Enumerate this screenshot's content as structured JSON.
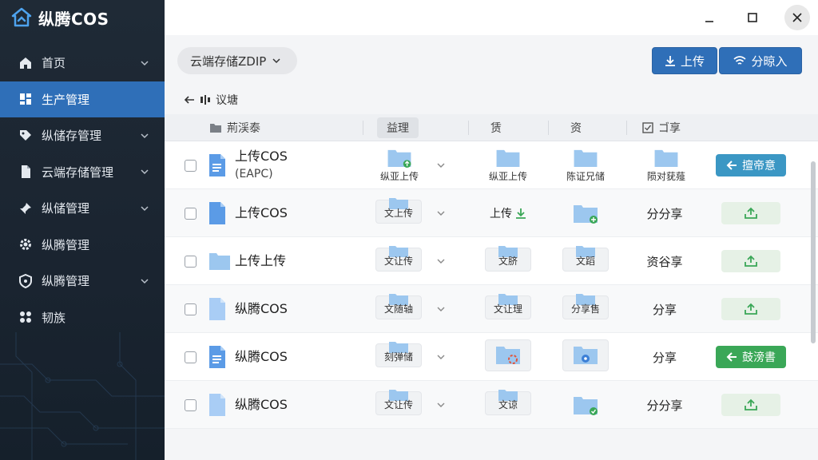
{
  "app": {
    "title": "纵腾COS"
  },
  "sidebar": {
    "items": [
      {
        "label": "首页",
        "icon": "home-icon",
        "chevron": true,
        "active": false
      },
      {
        "label": "生产管理",
        "icon": "grid-icon",
        "chevron": false,
        "active": true
      },
      {
        "label": "纵储存管理",
        "icon": "tag-icon",
        "chevron": true,
        "active": false
      },
      {
        "label": "云端存储管理",
        "icon": "document-icon",
        "chevron": true,
        "active": false
      },
      {
        "label": "纵储管理",
        "icon": "pin-icon",
        "chevron": true,
        "active": false
      },
      {
        "label": "纵腾管理",
        "icon": "gear-icon",
        "chevron": false,
        "active": false
      },
      {
        "label": "纵腾管理",
        "icon": "shield-icon",
        "chevron": true,
        "active": false
      },
      {
        "label": "韧族",
        "icon": "apps-icon",
        "chevron": false,
        "active": false
      }
    ]
  },
  "toolbar": {
    "location": "云端存储ZDIP",
    "upload_label": "上传",
    "share_label": "分晾入"
  },
  "breadcrumb": {
    "text": "议塘"
  },
  "table": {
    "headers": {
      "name": "荊渓泰",
      "manage": "益理",
      "c3": "赁",
      "c4": "资",
      "c5": "ゴ享"
    },
    "rows": [
      {
        "name": "上传COS",
        "sub": "(EAPC)",
        "file_icon": "doc-icon",
        "c2_caption": "纵亚上传",
        "c3_caption": "纵亚上传",
        "c4_caption": "陈证兄储",
        "c5_caption": "陨对莸薤",
        "action": {
          "style": "teal",
          "label": "擅帝意",
          "icon": "arrow-left-icon"
        }
      },
      {
        "name": "上传COS",
        "file_icon": "file-icon",
        "c2_tile": "文上传",
        "c3_text": "上传",
        "share": "分分享",
        "action": {
          "style": "light",
          "label": "",
          "icon": "share-up-icon"
        }
      },
      {
        "name": "上传上传",
        "file_icon": "folder-icon",
        "c2_tile": "文让传",
        "c3_tile": "文脐",
        "c4_tile": "文蹈",
        "share": "资谷享",
        "action": {
          "style": "light",
          "label": "",
          "icon": "share-up-icon"
        }
      },
      {
        "name": "纵腾COS",
        "file_icon": "file-icon",
        "c2_tile": "文随轴",
        "c3_tile": "文让理",
        "c4_tile": "分享售",
        "share": "分享",
        "action": {
          "style": "light",
          "label": "",
          "icon": "share-up-icon"
        }
      },
      {
        "name": "纵腾COS",
        "file_icon": "doc-icon",
        "c2_tile": "刻弹储",
        "share": "分享",
        "action": {
          "style": "green",
          "label": "鼓滂書",
          "icon": "arrow-left-icon"
        }
      },
      {
        "name": "纵腾COS",
        "file_icon": "file-icon",
        "c2_tile": "文让传",
        "c3_tile": "文谅",
        "share": "分分享",
        "action": {
          "style": "light",
          "label": "",
          "icon": "share-up-icon"
        }
      }
    ]
  },
  "colors": {
    "accent": "#2f6fb8",
    "teal": "#3b97c4",
    "green": "#3aa757",
    "folder": "#9cc7ef"
  }
}
